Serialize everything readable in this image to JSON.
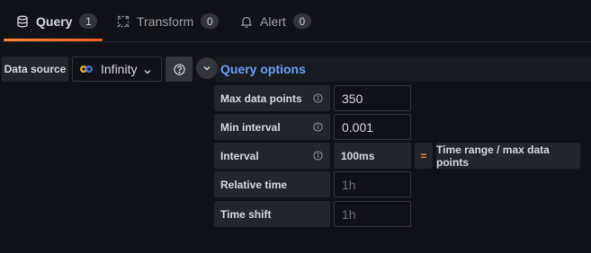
{
  "tabs": [
    {
      "label": "Query",
      "count": "1",
      "icon": "database-icon",
      "active": true
    },
    {
      "label": "Transform",
      "count": "0",
      "icon": "transform-icon",
      "active": false
    },
    {
      "label": "Alert",
      "count": "0",
      "icon": "bell-icon",
      "active": false
    }
  ],
  "datasource": {
    "label": "Data source",
    "selected": "Infinity"
  },
  "query_options": {
    "title": "Query options",
    "max_data_points": {
      "label": "Max data points",
      "value": "350"
    },
    "min_interval": {
      "label": "Min interval",
      "value": "0.001"
    },
    "interval": {
      "label": "Interval",
      "value": "100ms",
      "equals": "=",
      "formula": "Time range / max data points"
    },
    "relative_time": {
      "label": "Relative time",
      "placeholder": "1h"
    },
    "time_shift": {
      "label": "Time shift",
      "placeholder": "1h"
    }
  },
  "colors": {
    "background": "#111217",
    "accent": "#ff8833",
    "link": "#6e9fff",
    "label_bg": "#22252b"
  }
}
